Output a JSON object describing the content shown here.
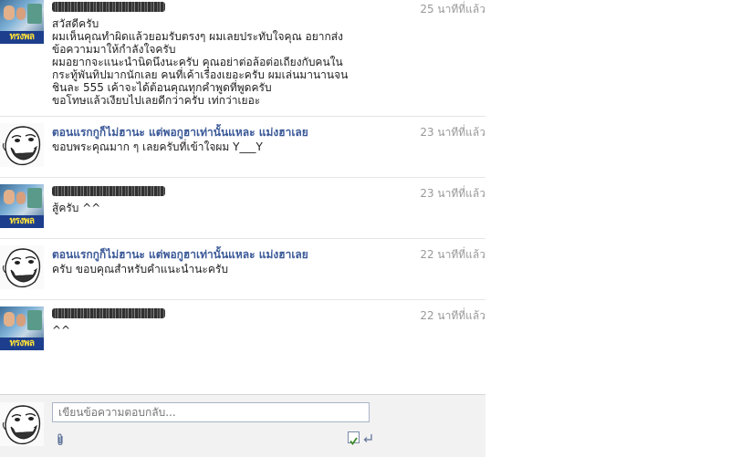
{
  "messages": [
    {
      "sender": "",
      "sender_redacted": true,
      "avatar": "page-photo-avatar",
      "avatar_text": "ทรงพล",
      "time": "25 นาทีที่แล้ว",
      "lines": [
        "สวัสดีครับ",
        "ผมเห็นคุณทำผิดแล้วยอมรับตรงๆ ผมเลยประทับใจคุณ อยากส่ง",
        "ข้อความมาให้กำลังใจครับ",
        "ผมอยากจะแนะนำนิดนึงนะครับ คุณอย่าต่อล้อต่อเถียงกับคนใน",
        "กระทู้พันทิปมากนักเลย คนที่เค้าเรื่องเยอะครับ ผมเล่นมานานจน",
        "ชินละ 555 เค้าจะได้ต้อนคุณทุกคำพูดที่พูดครับ",
        "ขอโทษแล้วเงียบไปเลยดีกว่าครับ เท่กว่าเยอะ"
      ]
    },
    {
      "sender": "ตอนแรกกูก็ไม่ฮานะ แต่พอกูฮาเท่านั้นแหละ แม่งฮาเลย",
      "sender_redacted": false,
      "avatar": "troll-face-avatar",
      "time": "23 นาทีที่แล้ว",
      "lines": [
        "ขอบพระคุณมาก ๆ เลยครับที่เข้าใจผม Y___Y"
      ]
    },
    {
      "sender": "",
      "sender_redacted": true,
      "avatar": "page-photo-avatar",
      "avatar_text": "ทรงพล",
      "time": "23 นาทีที่แล้ว",
      "lines": [
        "สู้ครับ ^^"
      ]
    },
    {
      "sender": "ตอนแรกกูก็ไม่ฮานะ แต่พอกูฮาเท่านั้นแหละ แม่งฮาเลย",
      "sender_redacted": false,
      "avatar": "troll-face-avatar",
      "time": "22 นาทีที่แล้ว",
      "lines": [
        "ครับ ขอบคุณสำหรับคำแนะนำนะครับ"
      ]
    },
    {
      "sender": "",
      "sender_redacted": true,
      "avatar": "page-photo-avatar",
      "avatar_text": "ทรงพล",
      "time": "22 นาทีที่แล้ว",
      "lines": [
        "^^"
      ]
    }
  ],
  "reply": {
    "placeholder": "เขียนข้อความตอบกลับ...",
    "enter_to_send_checked": true,
    "attach_icon": "paperclip-icon",
    "enter_icon": "return-arrow-icon"
  },
  "colors": {
    "name": "#3b5998",
    "time": "#999999",
    "reply_bg": "#f2f2f2",
    "check": "#3a8a2a"
  }
}
